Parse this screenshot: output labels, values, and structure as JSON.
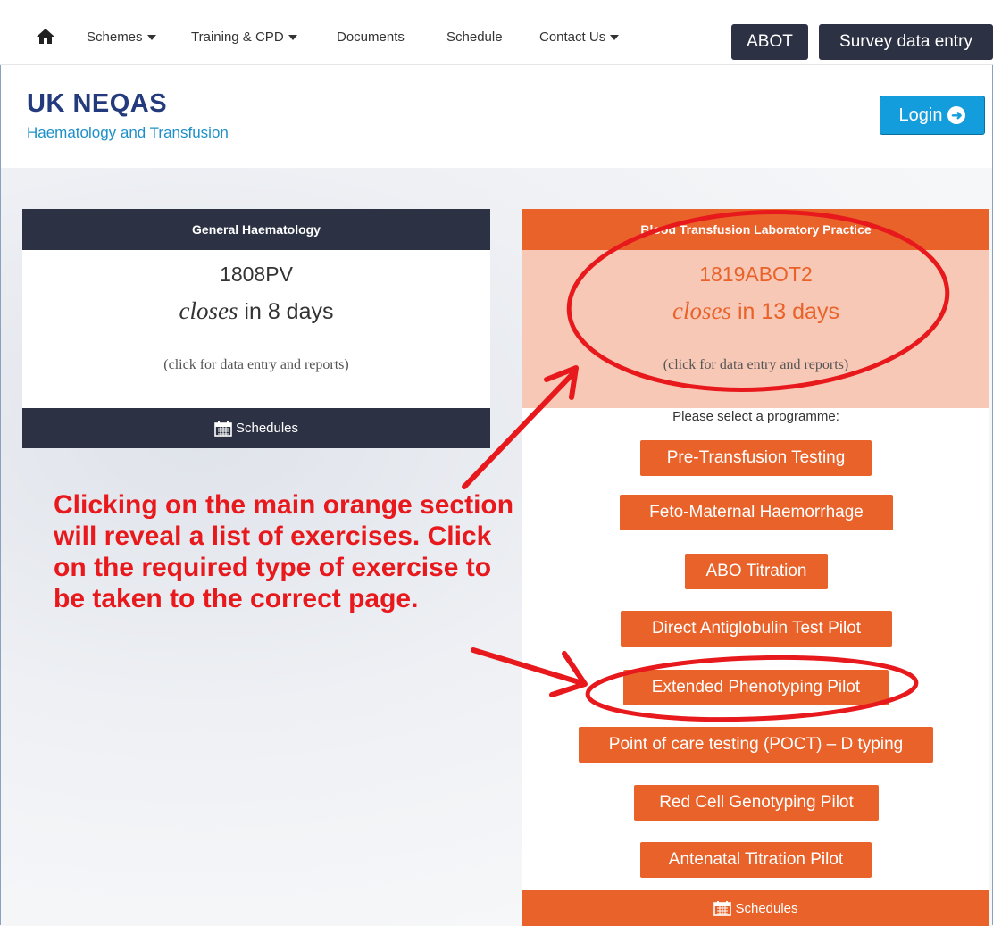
{
  "nav": {
    "items": [
      {
        "label": "Schemes",
        "dropdown": true
      },
      {
        "label": "Training & CPD",
        "dropdown": true
      },
      {
        "label": "Documents",
        "dropdown": false
      },
      {
        "label": "Schedule",
        "dropdown": false
      },
      {
        "label": "Contact Us",
        "dropdown": true
      }
    ],
    "abot_label": "ABOT",
    "survey_label": "Survey data entry"
  },
  "header": {
    "logo_title": "UK NEQAS",
    "logo_subtitle": "Haematology and Transfusion",
    "login_label": "Login"
  },
  "general": {
    "title": "General Haematology",
    "code": "1808PV",
    "closes_word": "closes",
    "closes_rest": " in 8 days",
    "note": "(click for data entry and reports)",
    "schedules_label": "Schedules"
  },
  "transfusion": {
    "title": "Blood Transfusion Laboratory Practice",
    "code": "1819ABOT2",
    "closes_word": "closes",
    "closes_rest": " in 13 days",
    "note": "(click for data entry and reports)",
    "select_label": "Please select a programme:",
    "programmes": [
      "Pre-Transfusion Testing",
      "Feto-Maternal Haemorrhage",
      "ABO Titration",
      "Direct Antiglobulin Test Pilot",
      "Extended Phenotyping Pilot",
      "Point of care testing (POCT) – D typing",
      "Red Cell Genotyping Pilot",
      "Antenatal Titration Pilot"
    ],
    "schedules_label": "Schedules"
  },
  "annotation": {
    "text": "Clicking on the main orange section will reveal a list of exercises. Click on the required type of exercise to be taken to the correct page."
  },
  "colors": {
    "navy": "#2d3144",
    "orange": "#e8622a",
    "peach": "#f8c8b6",
    "login_blue": "#149ddc",
    "annotation_red": "#e8191c"
  }
}
